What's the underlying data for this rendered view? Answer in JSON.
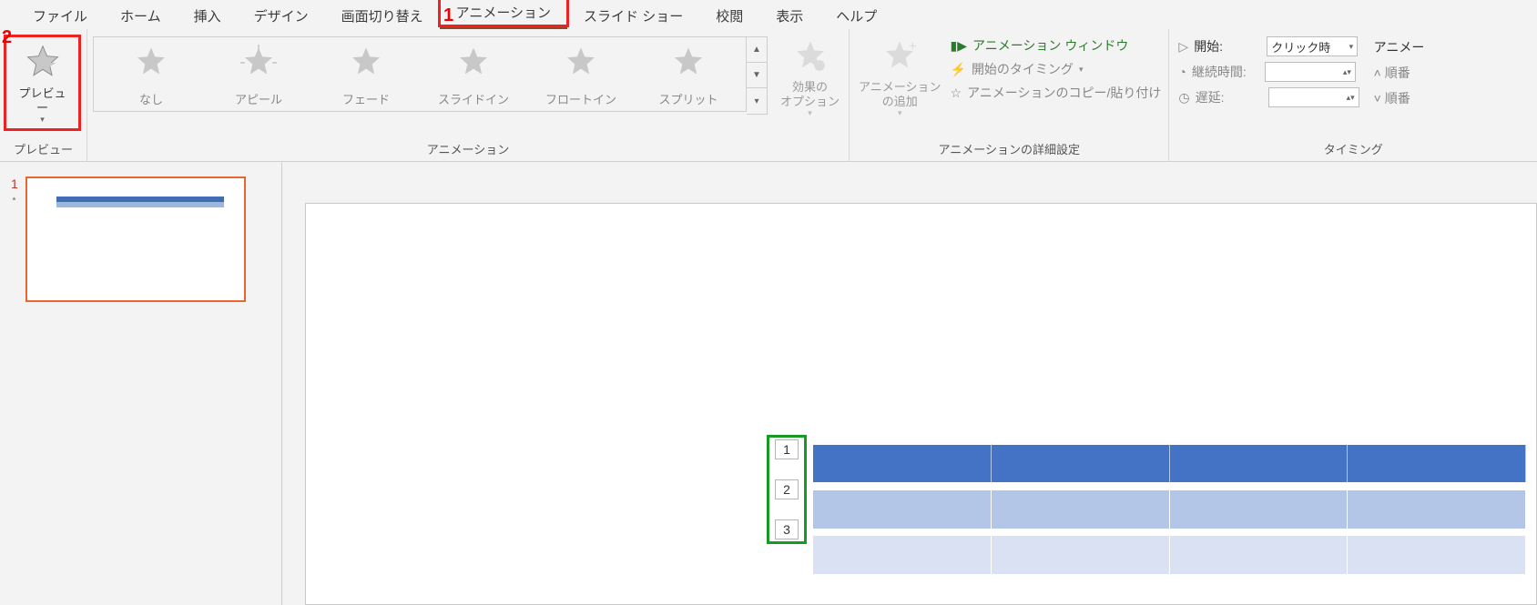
{
  "annotations": {
    "one": "1",
    "two": "2"
  },
  "tabs": {
    "file": "ファイル",
    "home": "ホーム",
    "insert": "挿入",
    "design": "デザイン",
    "transition": "画面切り替え",
    "animation": "アニメーション",
    "slideshow": "スライド ショー",
    "review": "校閲",
    "view": "表示",
    "help": "ヘルプ"
  },
  "ribbon": {
    "preview": {
      "label": "プレビュー",
      "group": "プレビュー"
    },
    "animation_group": "アニメーション",
    "gallery": {
      "none": "なし",
      "appear": "アピール",
      "fade": "フェード",
      "slidein": "スライドイン",
      "floatin": "フロートイン",
      "split": "スプリット"
    },
    "effect_options": "効果の\nオプション",
    "add_animation": "アニメーション\nの追加",
    "advanced_group": "アニメーションの詳細設定",
    "anim_pane": "アニメーション ウィンドウ",
    "trigger": "開始のタイミング",
    "painter": "アニメーションのコピー/貼り付け",
    "timing_group": "タイミング",
    "start_label": "開始:",
    "start_value": "クリック時",
    "duration_label": "継続時間:",
    "delay_label": "遅延:",
    "reorder_header": "アニメー",
    "reorder_earlier": "順番",
    "reorder_later": "順番"
  },
  "thumbnail": {
    "number": "1"
  },
  "anim_order": {
    "a": "1",
    "b": "2",
    "c": "3"
  }
}
